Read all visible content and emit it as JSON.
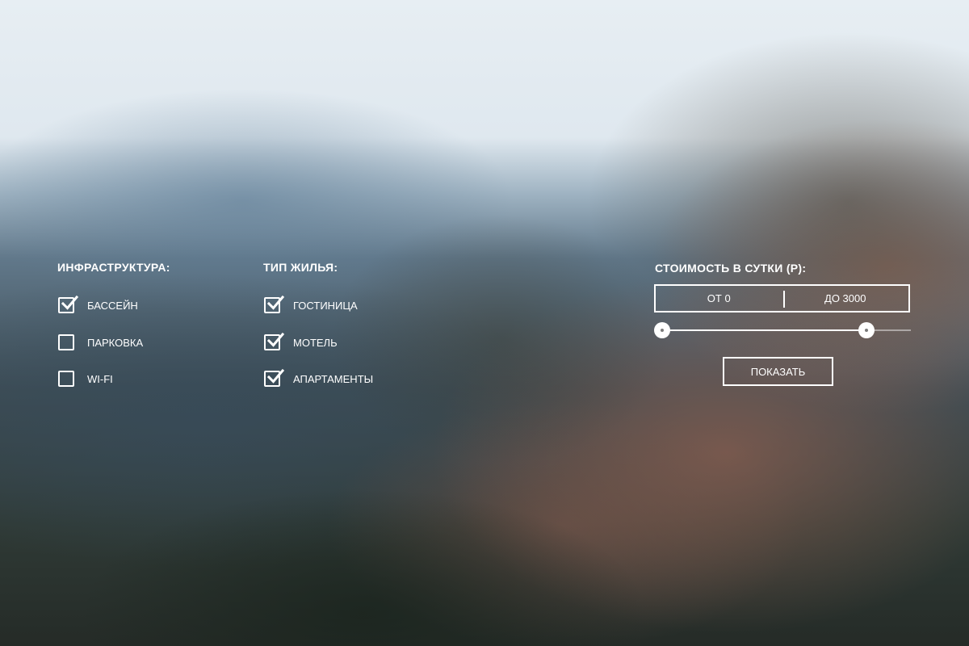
{
  "infrastructure": {
    "title": "ИНФРАСТРУКТУРА:",
    "items": [
      {
        "label": "БАССЕЙН",
        "checked": true
      },
      {
        "label": "ПАРКОВКА",
        "checked": false
      },
      {
        "label": "WI-FI",
        "checked": false
      }
    ]
  },
  "housing_type": {
    "title": "ТИП ЖИЛЬЯ:",
    "items": [
      {
        "label": "ГОСТИНИЦА",
        "checked": true
      },
      {
        "label": "МОТЕЛЬ",
        "checked": true
      },
      {
        "label": "АПАРТАМЕНТЫ",
        "checked": true
      }
    ]
  },
  "price": {
    "title": "СТОИМОСТЬ В СУТКИ (Р):",
    "from_label": "ОТ 0",
    "to_label": "ДО 3000",
    "slider": {
      "min_fraction": 0.0,
      "max_fraction": 0.82
    }
  },
  "submit": {
    "label": "ПОКАЗАТЬ"
  },
  "colors": {
    "foreground": "#ffffff"
  },
  "icons": {
    "checkbox_mark": "checkmark-icon"
  }
}
